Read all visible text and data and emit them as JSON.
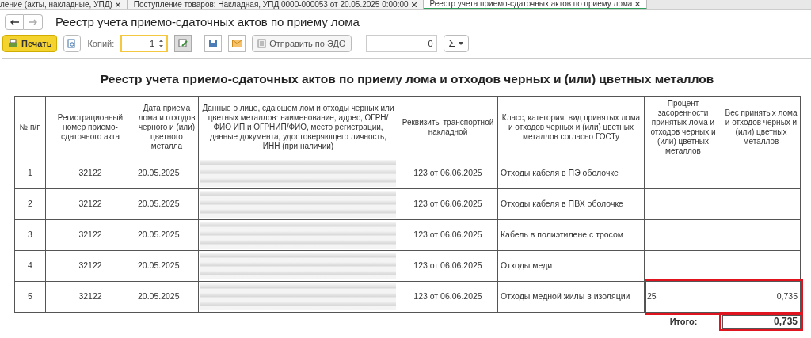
{
  "tabs": [
    {
      "label": "ление (акты, накладные, УПД)",
      "selected": false
    },
    {
      "label": "Поступление товаров: Накладная, УПД 0000-000053 от 20.05.2025 0:00:00",
      "selected": false
    },
    {
      "label": "Реестр учета приемо-сдаточных актов по приему лома",
      "selected": true
    }
  ],
  "window": {
    "title": "Реестр учета приемо-сдаточных актов по приему лома"
  },
  "toolbar": {
    "print_label": "Печать",
    "copies_label": "Копий:",
    "copies_value": "1",
    "send_label": "Отправить по ЭДО",
    "counter_value": "0",
    "sum_label": "Σ"
  },
  "report": {
    "title": "Реестр учета приемо-сдаточных актов по приему лома и отходов черных и (или) цветных металлов",
    "columns": [
      "№ п/п",
      "Регистрационный номер приемо-сдаточного акта",
      "Дата приема лома и отходов черного и (или) цветного металла",
      "Данные о лице, сдающем лом и отходы черных или цветных металлов: наименование, адрес, ОГРН/ФИО ИП и ОГРНИП/ФИО, место регистрации, данные документа, удостоверяющего личность, ИНН (при наличии)",
      "Реквизиты транспортной накладной",
      "Класс, категория, вид принятых лома и отходов черных и (или) цветных металлов согласно ГОСТу",
      "Процент засоренности принятых  лома и отходов черных и (или) цветных металлов",
      "Вес принятых лома и отходов черных и (или) цветных металлов"
    ],
    "rows": [
      {
        "num": "1",
        "act": "32122",
        "date": "20.05.2025",
        "waybill": "123 от 06.06.2025",
        "category": "Отходы кабеля в ПЭ оболочке",
        "highlighted": false
      },
      {
        "num": "2",
        "act": "32122",
        "date": "20.05.2025",
        "waybill": "123 от 06.06.2025",
        "category": "Отходы кабеля в ПВХ оболочке",
        "highlighted": false
      },
      {
        "num": "3",
        "act": "32122",
        "date": "20.05.2025",
        "waybill": "123 от 06.06.2025",
        "category": "Кабель в полиэтилене с тросом",
        "highlighted": false
      },
      {
        "num": "4",
        "act": "32122",
        "date": "20.05.2025",
        "waybill": "123 от 06.06.2025",
        "category": "Отходы меди",
        "highlighted": false
      },
      {
        "num": "5",
        "act": "32122",
        "date": "20.05.2025",
        "waybill": "123 от 06.06.2025",
        "category": "Отходы медной жилы в изоляции",
        "contamination": "25",
        "weight": "0,735",
        "highlighted": true
      }
    ],
    "total": {
      "label": "Итого:",
      "value": "0,735",
      "highlighted": true
    }
  }
}
